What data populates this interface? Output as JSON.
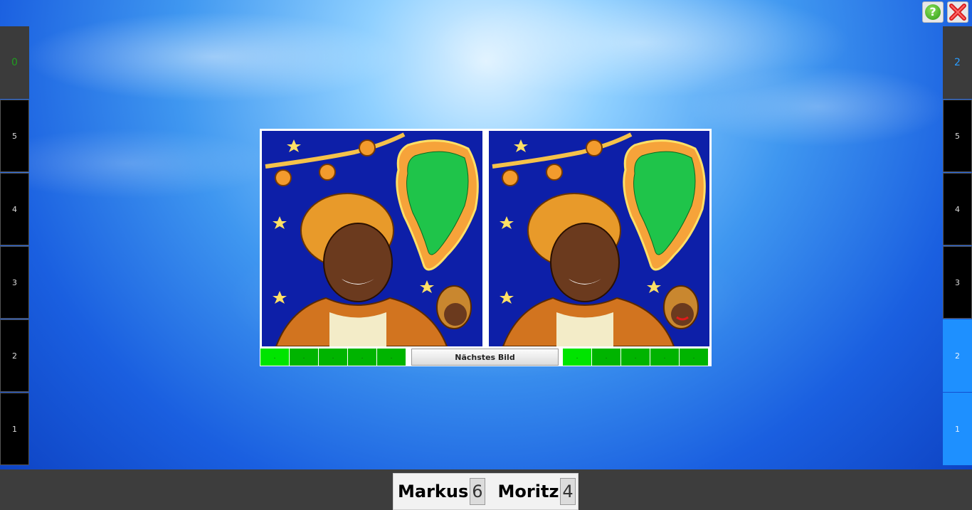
{
  "toolbar": {
    "help_icon_glyph": "?",
    "help_icon": "help-icon",
    "close_icon": "close-icon"
  },
  "left_column": {
    "score": "0",
    "levels": [
      "5",
      "4",
      "3",
      "2",
      "1"
    ],
    "accent_color": "#1f9e1f"
  },
  "right_column": {
    "score": "2",
    "levels": [
      "5",
      "4",
      "3",
      "2",
      "1"
    ],
    "filled_levels": 2,
    "accent_color": "#1e90ff"
  },
  "game": {
    "next_button_label": "Nächstes Bild",
    "left_progress": [
      ".",
      ".",
      ".",
      ".",
      "."
    ],
    "right_progress": [
      ".",
      ".",
      ".",
      ".",
      "."
    ]
  },
  "players": [
    {
      "name": "Markus",
      "score": "6"
    },
    {
      "name": "Moritz",
      "score": "4"
    }
  ]
}
